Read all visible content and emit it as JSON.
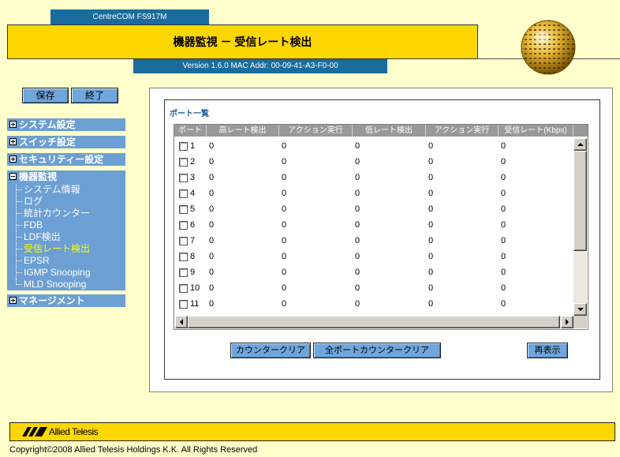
{
  "header": {
    "product_tab": "CentreCOM FS917M",
    "title": "機器監視 － 受信レート検出",
    "version_info": "Version 1.6.0 MAC Addr: 00-09-41-A3-F0-00"
  },
  "sidebar": {
    "save_label": "保存",
    "exit_label": "終了",
    "menus": [
      {
        "label": "システム設定",
        "icon": "plus-box-icon"
      },
      {
        "label": "スイッチ設定",
        "icon": "plus-box-icon"
      },
      {
        "label": "セキュリティー設定",
        "icon": "plus-box-icon"
      },
      {
        "label": "機器監視",
        "icon": "minus-box-icon",
        "children": [
          {
            "label": "システム情報"
          },
          {
            "label": "ログ"
          },
          {
            "label": "統計カウンター"
          },
          {
            "label": "FDB"
          },
          {
            "label": "LDF検出"
          },
          {
            "label": "受信レート検出",
            "selected": true
          },
          {
            "label": "EPSR"
          },
          {
            "label": "IGMP Snooping"
          },
          {
            "label": "MLD Snooping"
          }
        ]
      },
      {
        "label": "マネージメント",
        "icon": "plus-box-icon"
      }
    ]
  },
  "main": {
    "section_title": "ポート一覧",
    "table": {
      "columns": [
        "ポート",
        "高レート検出",
        "アクション実行",
        "低レート検出",
        "アクション実行",
        "受信レート(Kbps)"
      ],
      "rows": [
        {
          "port": "1",
          "checked": false,
          "high_rate_detect": "0",
          "high_action": "0",
          "low_rate_detect": "0",
          "low_action": "0",
          "rx_rate_kbps": "0"
        },
        {
          "port": "2",
          "checked": false,
          "high_rate_detect": "0",
          "high_action": "0",
          "low_rate_detect": "0",
          "low_action": "0",
          "rx_rate_kbps": "0"
        },
        {
          "port": "3",
          "checked": false,
          "high_rate_detect": "0",
          "high_action": "0",
          "low_rate_detect": "0",
          "low_action": "0",
          "rx_rate_kbps": "0"
        },
        {
          "port": "4",
          "checked": false,
          "high_rate_detect": "0",
          "high_action": "0",
          "low_rate_detect": "0",
          "low_action": "0",
          "rx_rate_kbps": "0"
        },
        {
          "port": "5",
          "checked": false,
          "high_rate_detect": "0",
          "high_action": "0",
          "low_rate_detect": "0",
          "low_action": "0",
          "rx_rate_kbps": "0"
        },
        {
          "port": "6",
          "checked": false,
          "high_rate_detect": "0",
          "high_action": "0",
          "low_rate_detect": "0",
          "low_action": "0",
          "rx_rate_kbps": "0"
        },
        {
          "port": "7",
          "checked": false,
          "high_rate_detect": "0",
          "high_action": "0",
          "low_rate_detect": "0",
          "low_action": "0",
          "rx_rate_kbps": "0"
        },
        {
          "port": "8",
          "checked": false,
          "high_rate_detect": "0",
          "high_action": "0",
          "low_rate_detect": "0",
          "low_action": "0",
          "rx_rate_kbps": "0"
        },
        {
          "port": "9",
          "checked": false,
          "high_rate_detect": "0",
          "high_action": "0",
          "low_rate_detect": "0",
          "low_action": "0",
          "rx_rate_kbps": "0"
        },
        {
          "port": "10",
          "checked": false,
          "high_rate_detect": "0",
          "high_action": "0",
          "low_rate_detect": "0",
          "low_action": "0",
          "rx_rate_kbps": "0"
        },
        {
          "port": "11",
          "checked": false,
          "high_rate_detect": "0",
          "high_action": "0",
          "low_rate_detect": "0",
          "low_action": "0",
          "rx_rate_kbps": "0"
        }
      ]
    },
    "buttons": {
      "counter_clear": "カウンタークリア",
      "clear_all_counters": "全ポートカウンタークリア",
      "refresh": "再表示"
    }
  },
  "footer": {
    "logo_text": "Allied Telesis",
    "copyright": "Copyright©2008 Allied Telesis Holdings K.K. All Rights Reserved"
  },
  "colors": {
    "page_background": "#FFFFCC",
    "tab_blue": "#1A6C9C",
    "menu_blue": "#6C9FD3",
    "button_blue": "#6FA6DC",
    "title_gold": "#FFD700",
    "selected_menu_text": "#FFFF00",
    "table_header_gray": "#999999"
  },
  "icons": {
    "globe": "globe-icon",
    "scroll_up": "arrow-up-icon",
    "scroll_down": "arrow-down-icon",
    "scroll_left": "arrow-left-icon",
    "scroll_right": "arrow-right-icon",
    "logo": "allied-telesis-logo-icon"
  }
}
